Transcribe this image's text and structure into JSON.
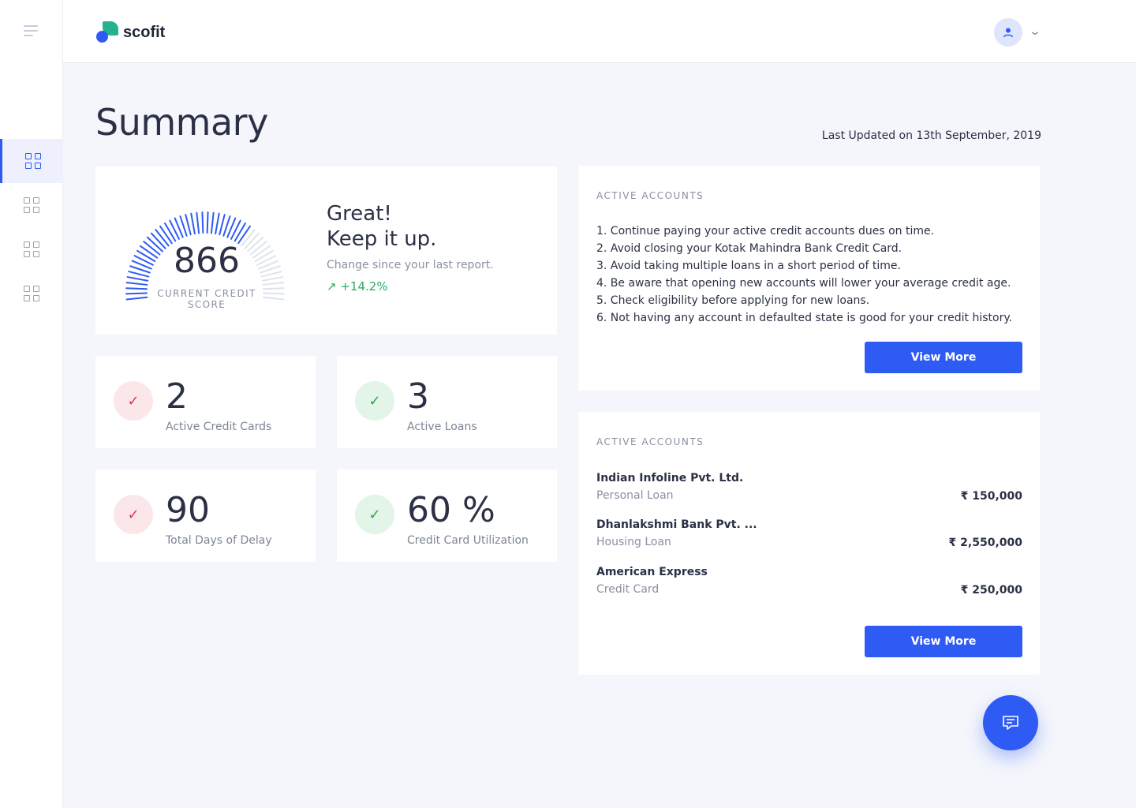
{
  "app": {
    "name": "scofit"
  },
  "page": {
    "title": "Summary",
    "last_updated": "Last Updated on 13th September, 2019"
  },
  "nav": {
    "items": [
      {
        "icon": "grid-icon",
        "active": true
      },
      {
        "icon": "grid-icon"
      },
      {
        "icon": "grid-icon"
      },
      {
        "icon": "grid-icon"
      }
    ]
  },
  "score": {
    "value": "866",
    "label": "CURRENT CREDIT SCORE",
    "line1": "Great!",
    "line2": "Keep it up.",
    "change_text": "Change since your last report.",
    "change_value": "+14.2%",
    "fill_fraction": 0.7
  },
  "stats": [
    {
      "value": "2",
      "label": "Active Credit Cards",
      "status": "red"
    },
    {
      "value": "3",
      "label": "Active Loans",
      "status": "green"
    },
    {
      "value": "90",
      "label": "Total Days of Delay",
      "status": "red"
    },
    {
      "value": "60 %",
      "label": "Credit Card Utilization",
      "status": "green"
    }
  ],
  "tips": {
    "heading": "ACTIVE ACCOUNTS",
    "items": [
      "1. Continue paying your active credit accounts dues on time.",
      "2. Avoid closing your Kotak Mahindra Bank Credit Card.",
      "3. Avoid taking multiple loans in a short period of time.",
      "4. Be aware that opening new accounts will lower your average credit age.",
      "5. Check eligibility before applying for new loans.",
      "6. Not having any account in defaulted state is good for your credit history."
    ],
    "button": "View More"
  },
  "accounts": {
    "heading": "ACTIVE ACCOUNTS",
    "items": [
      {
        "bank": "Indian Infoline Pvt. Ltd.",
        "type": "Personal Loan",
        "amount": "₹ 150,000"
      },
      {
        "bank": "Dhanlakshmi Bank Pvt. ...",
        "type": "Housing Loan",
        "amount": "₹ 2,550,000"
      },
      {
        "bank": "American Express",
        "type": "Credit Card",
        "amount": "₹ 250,000"
      }
    ],
    "button": "View More"
  },
  "colors": {
    "accent": "#2f5bf5",
    "success": "#27ae60",
    "danger": "#e0344f",
    "brand_green": "#24b38e"
  }
}
